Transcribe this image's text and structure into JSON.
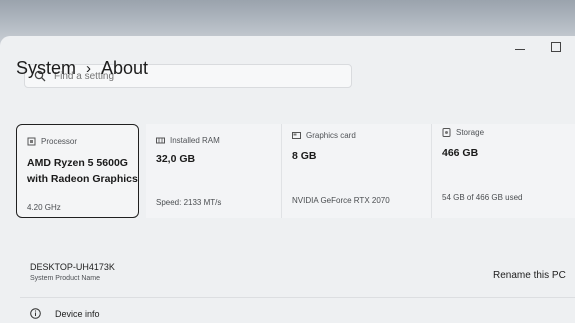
{
  "search": {
    "placeholder": "Find a setting"
  },
  "breadcrumb": {
    "parent": "System",
    "separator": "›",
    "current": "About"
  },
  "cards": {
    "processor": {
      "label": "Processor",
      "value_line1": "AMD Ryzen 5 5600G",
      "value_line2": "with Radeon Graphics",
      "sub": "4.20 GHz",
      "icon": "processor-icon"
    },
    "ram": {
      "label": "Installed RAM",
      "value": "32,0 GB",
      "sub": "Speed: 2133 MT/s",
      "icon": "ram-icon"
    },
    "graphics": {
      "label": "Graphics card",
      "value": "8 GB",
      "sub": "NVIDIA GeForce RTX 2070",
      "icon": "graphics-card-icon"
    },
    "storage": {
      "label": "Storage",
      "value": "466 GB",
      "sub": "54 GB of 466 GB used",
      "icon": "storage-icon"
    }
  },
  "device": {
    "name": "DESKTOP-UH4173K",
    "sub": "System Product Name",
    "rename_label": "Rename this PC"
  },
  "device_info": {
    "label": "Device info",
    "icon": "info-icon"
  },
  "colors": {
    "selected_border": "#202020",
    "background": "#eef0f2"
  }
}
